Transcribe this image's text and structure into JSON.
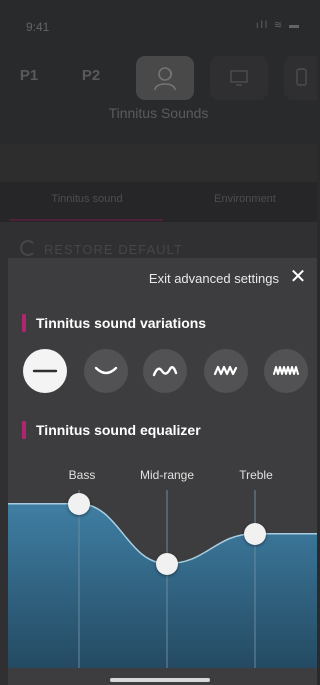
{
  "status_bar": {
    "time": "9:41",
    "icons": "ıll ≋ ▬"
  },
  "programs": {
    "items": [
      {
        "label": "P1"
      },
      {
        "label": "P2"
      }
    ],
    "selected_label": "Tinnitus Sounds"
  },
  "tabs": [
    {
      "label": "Tinnitus sound"
    },
    {
      "label": "Environment"
    }
  ],
  "restore_default": "RESTORE DEFAULT",
  "advanced": {
    "exit_label": "Exit advanced settings",
    "close_glyph": "✕",
    "variations_title": "Tinnitus sound variations",
    "variations": [
      {
        "name": "flat",
        "selected": true
      },
      {
        "name": "slow-wave",
        "selected": false
      },
      {
        "name": "medium-wave",
        "selected": false
      },
      {
        "name": "fast-wave",
        "selected": false
      },
      {
        "name": "very-fast-wave",
        "selected": false
      }
    ],
    "equalizer_title": "Tinnitus sound equalizer",
    "equalizer": {
      "bands": [
        {
          "label": "Bass",
          "level": 0.88
        },
        {
          "label": "Mid-range",
          "level": 0.36
        },
        {
          "label": "Treble",
          "level": 0.62
        }
      ]
    }
  },
  "colors": {
    "accent": "#b0256f",
    "eq_fill_top": "#3f7ea3",
    "eq_fill_bottom": "#244a62",
    "eq_line": "#a8cde2"
  }
}
